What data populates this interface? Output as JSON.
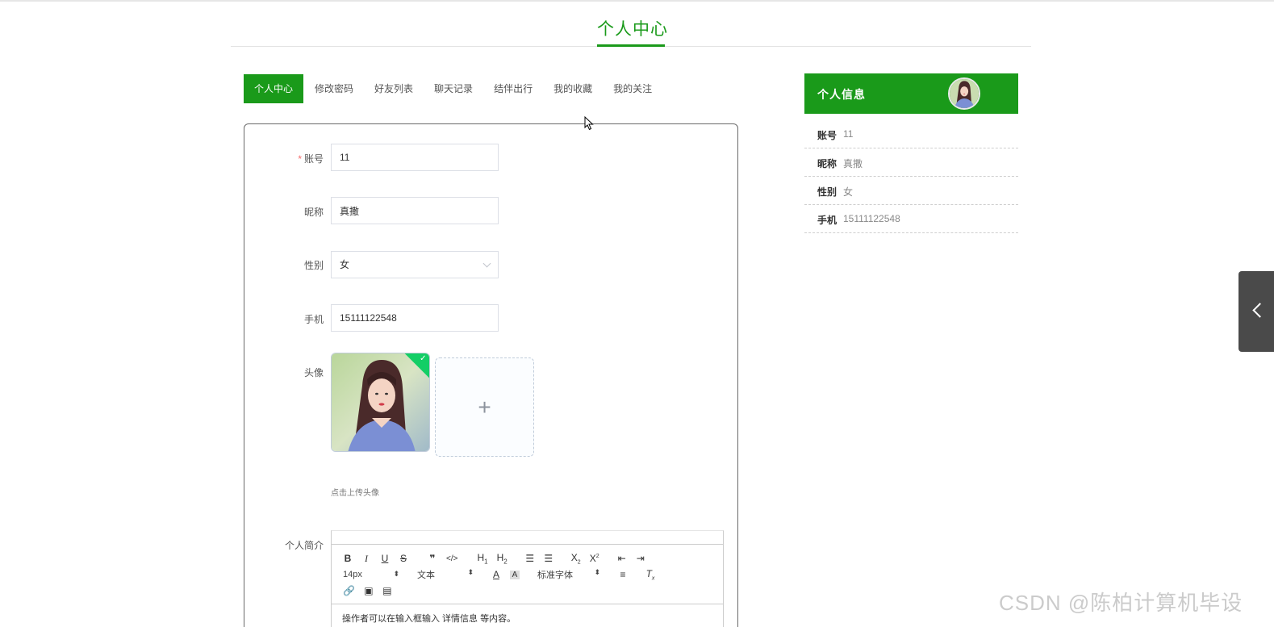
{
  "page": {
    "title": "个人中心"
  },
  "tabs": [
    {
      "label": "个人中心",
      "active": true
    },
    {
      "label": "修改密码"
    },
    {
      "label": "好友列表"
    },
    {
      "label": "聊天记录"
    },
    {
      "label": "结伴出行"
    },
    {
      "label": "我的收藏"
    },
    {
      "label": "我的关注"
    }
  ],
  "form": {
    "account": {
      "label": "账号",
      "required": true,
      "value": "11"
    },
    "nickname": {
      "label": "昵称",
      "value": "真撒"
    },
    "gender": {
      "label": "性别",
      "value": "女"
    },
    "phone": {
      "label": "手机",
      "value": "15111122548"
    },
    "avatar": {
      "label": "头像",
      "tip": "点击上传头像",
      "upload_icon": "plus-icon"
    },
    "bio": {
      "label": "个人简介",
      "toolbar": {
        "font_size": "14px",
        "header": "文本",
        "font_family": "标准字体"
      },
      "content": "操作者可以在输入框输入 详情信息 等内容。"
    }
  },
  "sidebar": {
    "title": "个人信息",
    "rows": [
      {
        "key": "账号",
        "value": "11"
      },
      {
        "key": "昵称",
        "value": "真撒"
      },
      {
        "key": "性别",
        "value": "女"
      },
      {
        "key": "手机",
        "value": "15111122548"
      }
    ]
  },
  "watermark": "CSDN @陈柏计算机毕设",
  "colors": {
    "accent": "#1a9a1a",
    "required": "#f56c6c",
    "success": "#13ce66"
  }
}
